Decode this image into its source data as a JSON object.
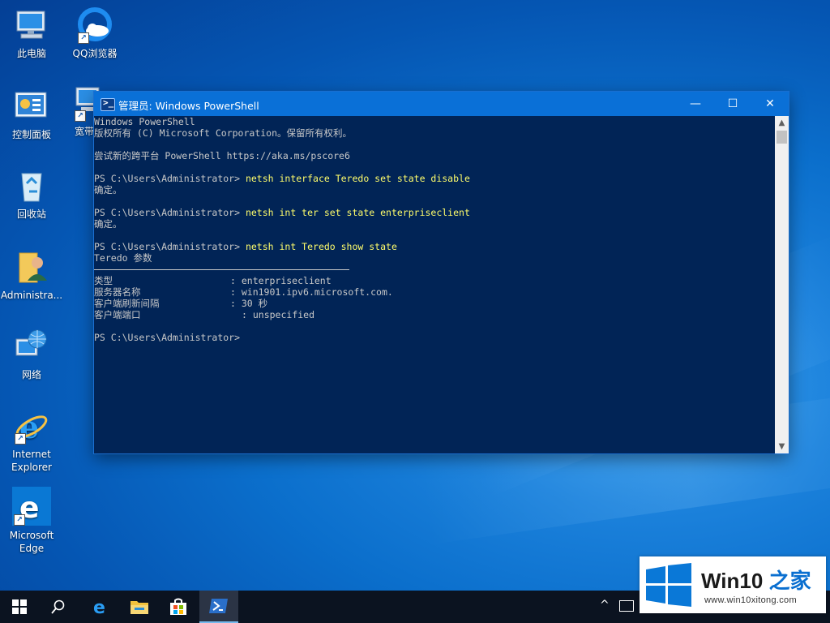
{
  "desktop": {
    "icons": [
      {
        "label": "此电脑"
      },
      {
        "label": "QQ浏览器"
      },
      {
        "label": "控制面板"
      },
      {
        "label": "宽带"
      },
      {
        "label": "回收站"
      },
      {
        "label": "Administra..."
      },
      {
        "label": "网络"
      },
      {
        "label": "Internet Explorer"
      },
      {
        "label": "Microsoft Edge"
      }
    ]
  },
  "window": {
    "title": "管理员: Windows PowerShell",
    "controls": {
      "minimize": "—",
      "maximize": "☐",
      "close": "✕"
    },
    "console": {
      "l1": "Windows PowerShell",
      "l2": "版权所有 (C) Microsoft Corporation。保留所有权利。",
      "l3": "尝试新的跨平台 PowerShell https://aka.ms/pscore6",
      "prompt": "PS C:\\Users\\Administrator> ",
      "cmd1": "netsh interface Teredo set state disable",
      "ok1": "确定。",
      "cmd2": "netsh int ter set state enterpriseclient",
      "ok2": "确定。",
      "cmd3": "netsh int Teredo show state",
      "heading": "Teredo 参数",
      "params": [
        {
          "key": "类型",
          "sep": ": ",
          "value": "enterpriseclient"
        },
        {
          "key": "服务器名称",
          "sep": ": ",
          "value": "win1901.ipv6.microsoft.com."
        },
        {
          "key": "客户端刷新间隔",
          "sep": ": ",
          "value": "30 秒"
        },
        {
          "key": "客户端端口",
          "sep": ": ",
          "value": "unspecified"
        }
      ],
      "final_prompt": "PS C:\\Users\\Administrator>"
    }
  },
  "watermark": {
    "brand_main": "Win10",
    "brand_accent": "之家",
    "url": "www.win10xitong.com"
  },
  "colors": {
    "console_bg": "#012456",
    "console_text": "#c8c8c8",
    "command_text": "#fffd6b",
    "titlebar": "#0a70d7"
  }
}
